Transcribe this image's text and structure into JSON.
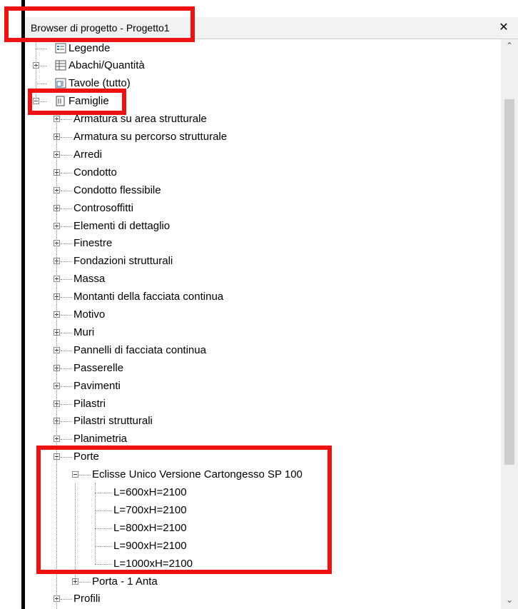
{
  "panel": {
    "title": "Browser di progetto - Progetto1",
    "close_symbol": "✕"
  },
  "scrollbar": {
    "up_arrow": "⌃",
    "down_arrow": "⌄"
  },
  "tree": {
    "top_items": [
      {
        "label": "Legende",
        "icon": "legend-icon",
        "state": "leaf"
      },
      {
        "label": "Abachi/Quantità",
        "icon": "schedule-icon",
        "state": "collapsed"
      },
      {
        "label": "Tavole (tutto)",
        "icon": "sheet-icon",
        "state": "leaf"
      },
      {
        "label": "Famiglie",
        "icon": "family-icon",
        "state": "expanded"
      }
    ],
    "family_categories": [
      "Armatura su area strutturale",
      "Armatura su percorso strutturale",
      "Arredi",
      "Condotto",
      "Condotto flessibile",
      "Controsoffitti",
      "Elementi di dettaglio",
      "Finestre",
      "Fondazioni strutturali",
      "Massa",
      "Montanti della facciata continua",
      "Motivo",
      "Muri",
      "Pannelli di facciata continua",
      "Passerelle",
      "Pavimenti",
      "Pilastri",
      "Pilastri strutturali",
      "Planimetria"
    ],
    "porte": {
      "label": "Porte",
      "family": {
        "label": "Eclisse Unico Versione Cartongesso SP 100",
        "types": [
          "L=600xH=2100",
          "L=700xH=2100",
          "L=800xH=2100",
          "L=900xH=2100",
          "L=1000xH=2100"
        ]
      },
      "other_family": "Porta - 1 Anta"
    },
    "after_porte": [
      "Profili"
    ]
  },
  "highlight_color": "#ee1111"
}
